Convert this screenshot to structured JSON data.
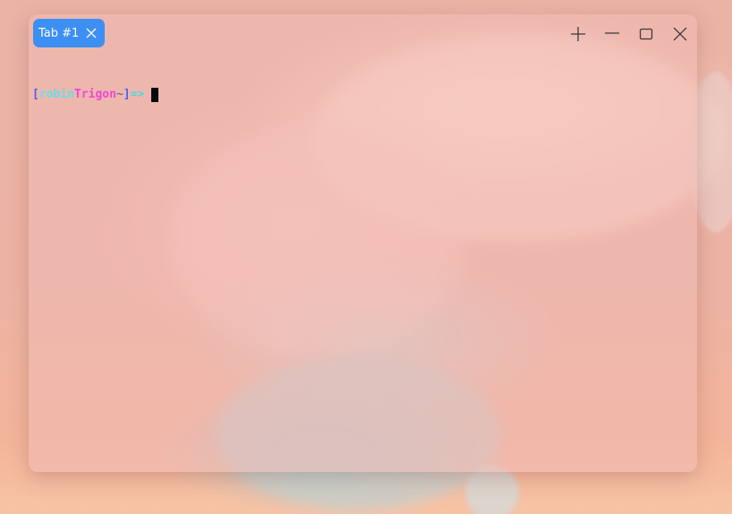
{
  "window": {
    "tabs": [
      {
        "label": "Tab #1",
        "active": true
      }
    ],
    "controls": {
      "new_tab_icon": "plus-icon",
      "minimize_icon": "minimize-icon",
      "maximize_icon": "maximize-icon",
      "close_icon": "close-icon"
    }
  },
  "terminal": {
    "prompt": {
      "open_bracket": "[",
      "user": "robin",
      "host": "Trigon",
      "path": "~",
      "close_bracket": "]",
      "arrow": "=>"
    }
  },
  "colors": {
    "tab_active": "#3d8ff3",
    "prompt_bracket": "#4e5cf0",
    "prompt_user": "#5fe0ea",
    "prompt_host": "#f046d6",
    "prompt_arrow": "#4fd4dd"
  }
}
